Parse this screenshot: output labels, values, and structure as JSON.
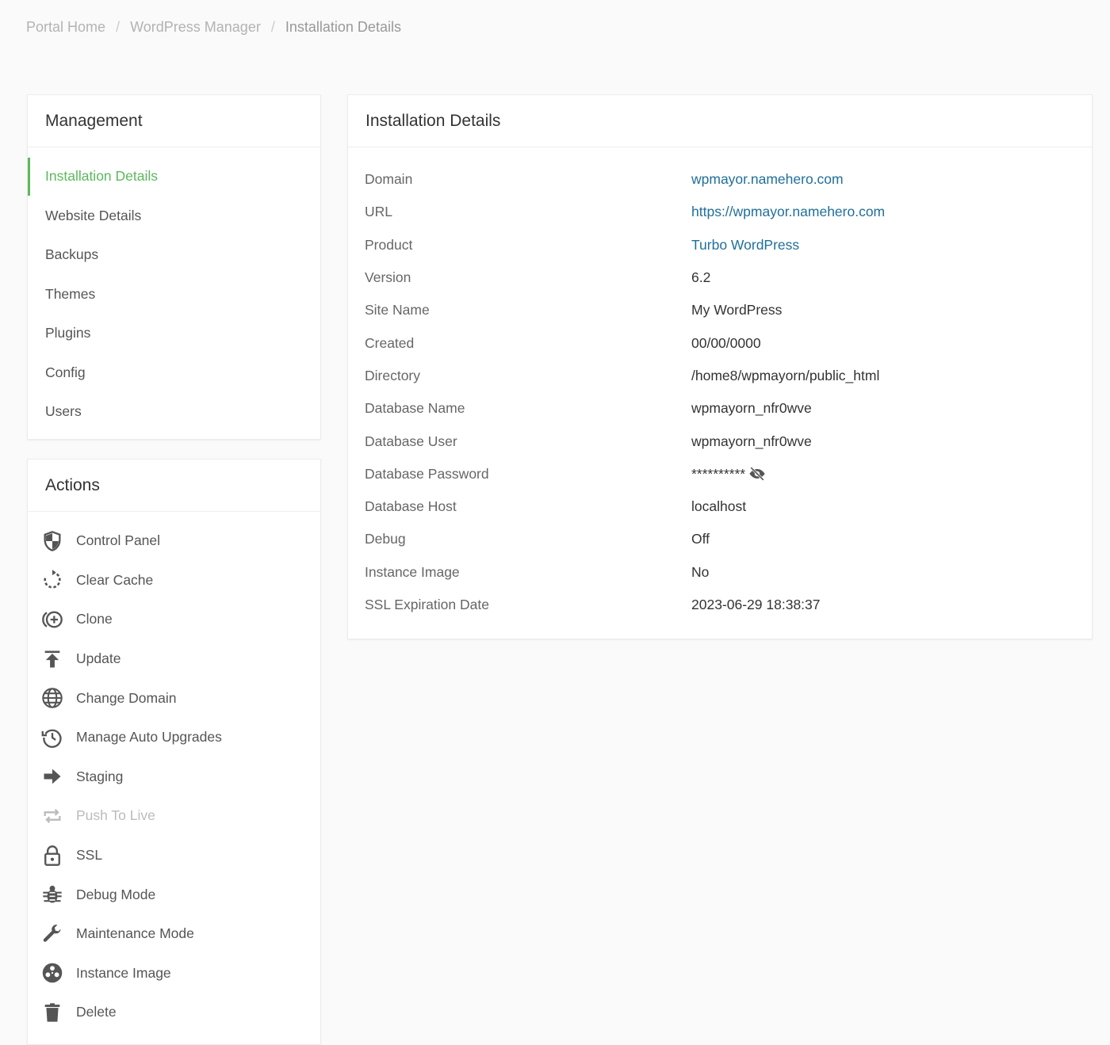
{
  "breadcrumb": {
    "items": [
      "Portal Home",
      "WordPress Manager"
    ],
    "current": "Installation Details",
    "separator": "/"
  },
  "management": {
    "title": "Management",
    "items": [
      {
        "label": "Installation Details",
        "active": true
      },
      {
        "label": "Website Details"
      },
      {
        "label": "Backups"
      },
      {
        "label": "Themes"
      },
      {
        "label": "Plugins"
      },
      {
        "label": "Config"
      },
      {
        "label": "Users"
      }
    ]
  },
  "actions": {
    "title": "Actions",
    "items": [
      {
        "label": "Control Panel",
        "icon": "shield-icon"
      },
      {
        "label": "Clear Cache",
        "icon": "refresh-icon"
      },
      {
        "label": "Clone",
        "icon": "clone-icon"
      },
      {
        "label": "Update",
        "icon": "upload-icon"
      },
      {
        "label": "Change Domain",
        "icon": "globe-icon"
      },
      {
        "label": "Manage Auto Upgrades",
        "icon": "history-icon"
      },
      {
        "label": "Staging",
        "icon": "arrow-right-icon"
      },
      {
        "label": "Push To Live",
        "icon": "repeat-icon",
        "disabled": true
      },
      {
        "label": "SSL",
        "icon": "lock-icon"
      },
      {
        "label": "Debug Mode",
        "icon": "bug-icon"
      },
      {
        "label": "Maintenance Mode",
        "icon": "wrench-icon"
      },
      {
        "label": "Instance Image",
        "icon": "film-reel-icon"
      },
      {
        "label": "Delete",
        "icon": "trash-icon"
      }
    ]
  },
  "details": {
    "title": "Installation Details",
    "rows": [
      {
        "label": "Domain",
        "value": "wpmayor.namehero.com",
        "link": true
      },
      {
        "label": "URL",
        "value": "https://wpmayor.namehero.com",
        "link": true
      },
      {
        "label": "Product",
        "value": "Turbo WordPress",
        "link": true
      },
      {
        "label": "Version",
        "value": "6.2"
      },
      {
        "label": "Site Name",
        "value": "My WordPress"
      },
      {
        "label": "Created",
        "value": "00/00/0000"
      },
      {
        "label": "Directory",
        "value": "/home8/wpmayorn/public_html"
      },
      {
        "label": "Database Name",
        "value": "wpmayorn_nfr0wve"
      },
      {
        "label": "Database User",
        "value": "wpmayorn_nfr0wve"
      },
      {
        "label": "Database Password",
        "value": "**********",
        "icon": "eye-slash-icon"
      },
      {
        "label": "Database Host",
        "value": "localhost"
      },
      {
        "label": "Debug",
        "value": "Off"
      },
      {
        "label": "Instance Image",
        "value": "No"
      },
      {
        "label": "SSL Expiration Date",
        "value": "2023-06-29 18:38:37"
      }
    ]
  },
  "colors": {
    "accent_green": "#5cb85c",
    "link_blue": "#1f6f9b",
    "icon_gray": "#555555"
  }
}
